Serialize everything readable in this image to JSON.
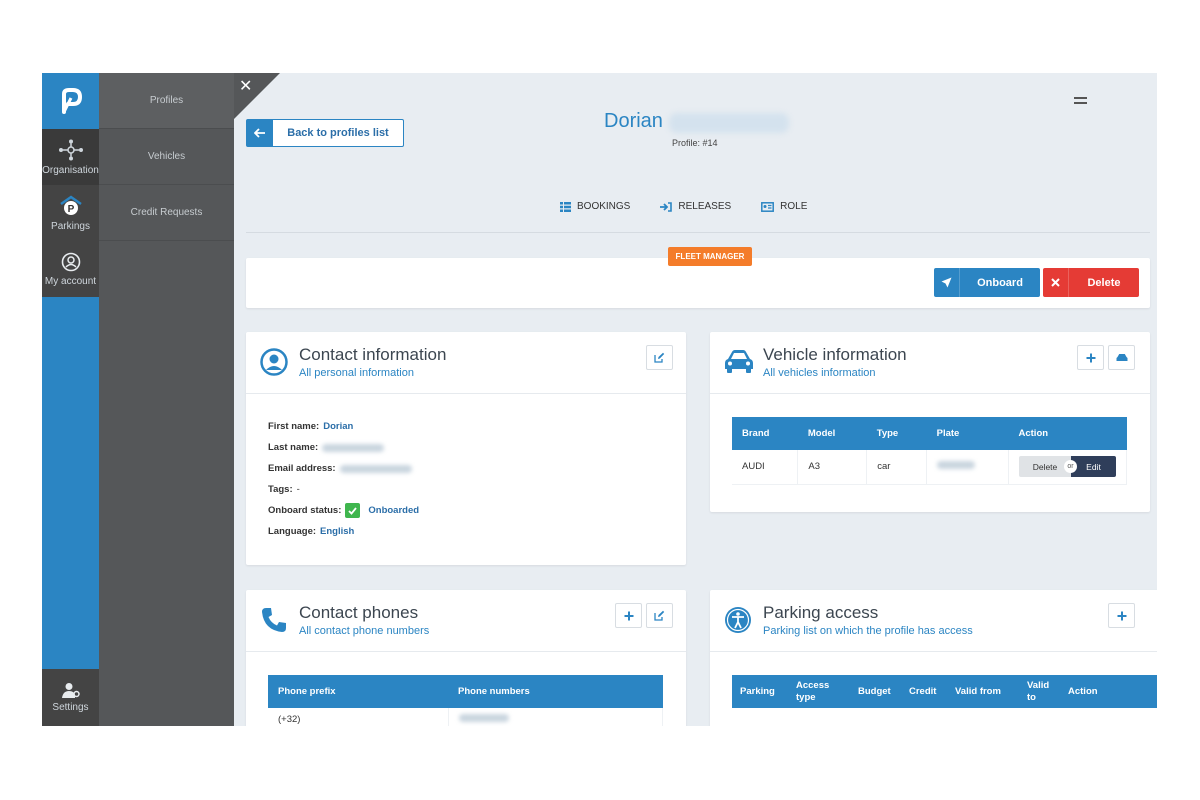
{
  "nav": {
    "rail": [
      {
        "label": "Organisation",
        "icon": "organisation-icon"
      },
      {
        "label": "Parkings",
        "icon": "parking-icon"
      },
      {
        "label": "My account",
        "icon": "account-icon"
      }
    ],
    "settings_label": "Settings",
    "submenu": [
      "Profiles",
      "Vehicles",
      "Credit Requests"
    ]
  },
  "header": {
    "back_label": "Back to profiles list",
    "first_name": "Dorian",
    "profile_number": "Profile: #14"
  },
  "tabs": [
    {
      "label": "BOOKINGS",
      "icon": "list-icon"
    },
    {
      "label": "RELEASES",
      "icon": "sign-in-icon"
    },
    {
      "label": "ROLE",
      "icon": "id-card-icon"
    }
  ],
  "role_badge": "FLEET MANAGER",
  "actions": {
    "onboard": "Onboard",
    "delete": "Delete"
  },
  "contact": {
    "title": "Contact information",
    "subtitle": "All personal information",
    "first_name_label": "First name:",
    "first_name": "Dorian",
    "last_name_label": "Last name:",
    "email_label": "Email address:",
    "tags_label": "Tags:",
    "tags": "-",
    "onboard_label": "Onboard status:",
    "onboard_status": "Onboarded",
    "language_label": "Language:",
    "language": "English"
  },
  "vehicle": {
    "title": "Vehicle information",
    "subtitle": "All vehicles information",
    "columns": [
      "Brand",
      "Model",
      "Type",
      "Plate",
      "Action"
    ],
    "rows": [
      {
        "brand": "AUDI",
        "model": "A3",
        "type": "car"
      }
    ],
    "delete_label": "Delete",
    "or_label": "or",
    "edit_label": "Edit"
  },
  "phones": {
    "title": "Contact phones",
    "subtitle": "All contact phone numbers",
    "columns": [
      "Phone prefix",
      "Phone numbers"
    ],
    "rows": [
      {
        "prefix": "(+32)"
      }
    ]
  },
  "parking": {
    "title": "Parking access",
    "subtitle": "Parking list on which the profile has access",
    "columns": [
      "Parking",
      "Access type",
      "Budget",
      "Credit",
      "Valid from",
      "Valid to",
      "Action"
    ]
  },
  "colors": {
    "primary": "#2b85c3",
    "danger": "#e53b35",
    "badge": "#f47c2a",
    "success": "#3fb64e"
  }
}
